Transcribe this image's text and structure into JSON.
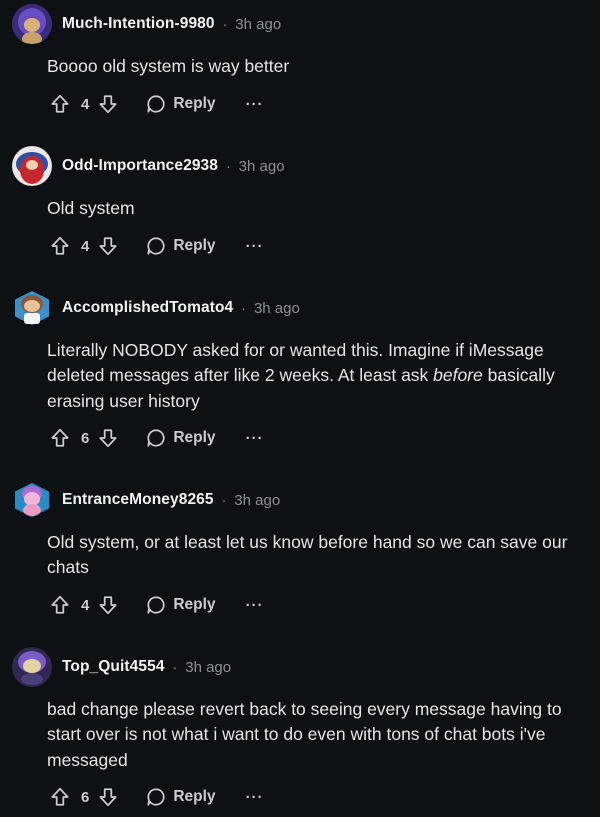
{
  "comments": [
    {
      "username": "Much-Intention-9980",
      "time": "3h ago",
      "text": "Boooo old system is way better",
      "votes": "4",
      "reply_label": "Reply",
      "more": "···",
      "avatar_colors": [
        "#5b3fa8",
        "#c9a26b",
        "#2a2350"
      ]
    },
    {
      "username": "Odd-Importance2938",
      "time": "3h ago",
      "text": "Old system",
      "votes": "4",
      "reply_label": "Reply",
      "more": "···",
      "avatar_colors": [
        "#e9e3e4",
        "#c4282e",
        "#2f4fa0"
      ]
    },
    {
      "username": "AccomplishedTomato4",
      "time": "3h ago",
      "text_parts": [
        "Literally NOBODY asked for or wanted this. Imagine if iMessage deleted messages after like 2 weeks. At least ask ",
        "before",
        " basically erasing user history"
      ],
      "votes": "6",
      "reply_label": "Reply",
      "more": "···",
      "avatar_colors": [
        "#3c8fc9",
        "#8a5a3a",
        "#f4f4f4"
      ]
    },
    {
      "username": "EntranceMoney8265",
      "time": "3h ago",
      "text": "Old system, or at least let us know before hand so we can save our chats",
      "votes": "4",
      "reply_label": "Reply",
      "more": "···",
      "avatar_colors": [
        "#2b8cc4",
        "#f2b6d9",
        "#b06bd0"
      ]
    },
    {
      "username": "Top_Quit4554",
      "time": "3h ago",
      "text": "bad change please revert back to seeing every message having to start over is not what i want to do even with tons of chat bots i've messaged",
      "votes": "6",
      "reply_label": "Reply",
      "more": "···",
      "avatar_colors": [
        "#4a3f7a",
        "#7c5bc7",
        "#e2d3a3"
      ]
    }
  ],
  "separator": "·"
}
